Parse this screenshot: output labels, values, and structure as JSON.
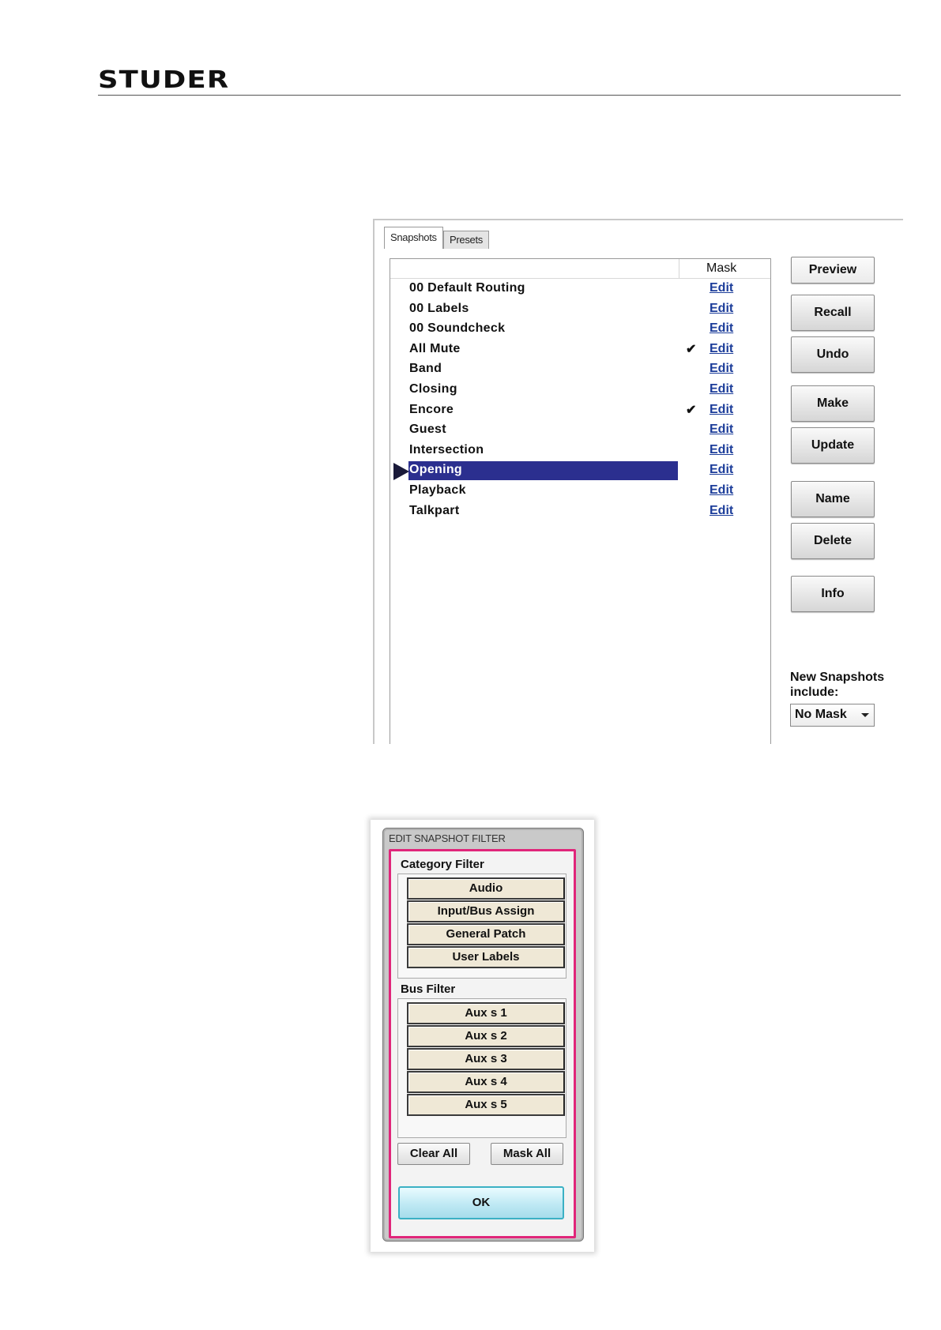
{
  "header": {
    "logo_text": "STUDER"
  },
  "snapshots_window": {
    "tabs": [
      {
        "label": "Snapshots",
        "active": true
      },
      {
        "label": "Presets",
        "active": false
      }
    ],
    "mask_column_label": "Mask",
    "rows": [
      {
        "name": "00 Default Routing",
        "masked": false,
        "edit_label": "Edit"
      },
      {
        "name": "00 Labels",
        "masked": false,
        "edit_label": "Edit"
      },
      {
        "name": "00 Soundcheck",
        "masked": false,
        "edit_label": "Edit"
      },
      {
        "name": "All Mute",
        "masked": true,
        "edit_label": "Edit"
      },
      {
        "name": "Band",
        "masked": false,
        "edit_label": "Edit"
      },
      {
        "name": "Closing",
        "masked": false,
        "edit_label": "Edit"
      },
      {
        "name": "Encore",
        "masked": true,
        "edit_label": "Edit"
      },
      {
        "name": "Guest",
        "masked": false,
        "edit_label": "Edit"
      },
      {
        "name": "Intersection",
        "masked": false,
        "edit_label": "Edit"
      },
      {
        "name": "Opening",
        "masked": false,
        "edit_label": "Edit",
        "selected": true
      },
      {
        "name": "Playback",
        "masked": false,
        "edit_label": "Edit"
      },
      {
        "name": "Talkpart",
        "masked": false,
        "edit_label": "Edit"
      }
    ],
    "check_glyph": "✔",
    "buttons": {
      "preview": "Preview",
      "recall": "Recall",
      "undo": "Undo",
      "make": "Make",
      "update": "Update",
      "name": "Name",
      "delete": "Delete",
      "info": "Info"
    },
    "new_snapshots_label_line1": "New Snapshots",
    "new_snapshots_label_line2": "include:",
    "new_snapshots_value": "No Mask",
    "selection_color": "#2b2f8f",
    "link_color": "#1c3d9a"
  },
  "filter_dialog": {
    "title": "EDIT SNAPSHOT FILTER",
    "category_label": "Category Filter",
    "categories": [
      "Audio",
      "Input/Bus Assign",
      "General Patch",
      "User Labels"
    ],
    "bus_label": "Bus Filter",
    "buses": [
      "Aux s  1",
      "Aux s  2",
      "Aux s  3",
      "Aux s  4",
      "Aux s  5"
    ],
    "clear_all": "Clear All",
    "mask_all": "Mask All",
    "ok": "OK",
    "frame_color": "#e0267a"
  }
}
